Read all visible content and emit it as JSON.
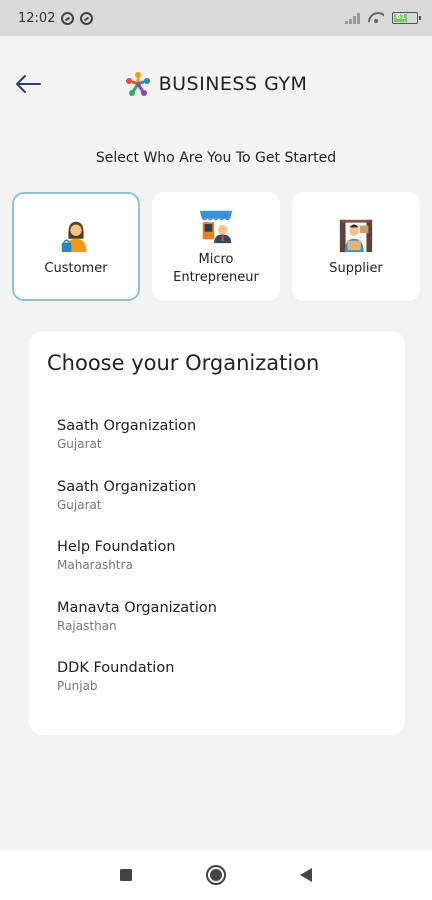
{
  "status_bar": {
    "time": "12:02",
    "battery_level": "61"
  },
  "header": {
    "title": "BUSINESS GYM"
  },
  "prompt": "Select Who Are You To Get Started",
  "roles": [
    {
      "label": "Customer",
      "selected": true
    },
    {
      "label": "Micro Entrepreneur",
      "selected": false
    },
    {
      "label": "Supplier",
      "selected": false
    }
  ],
  "organization_section": {
    "heading": "Choose your Organization",
    "items": [
      {
        "name": "Saath Organization",
        "state": "Gujarat"
      },
      {
        "name": "Saath Organization",
        "state": "Gujarat"
      },
      {
        "name": "Help Foundation",
        "state": "Maharashtra"
      },
      {
        "name": "Manavta Organization",
        "state": "Rajasthan"
      },
      {
        "name": "DDK Foundation",
        "state": "Punjab"
      }
    ]
  },
  "colors": {
    "selected_border": "#8ec3cc",
    "logo_orange": "#f39c12",
    "logo_blue": "#2e86c1",
    "logo_red": "#e74c3c",
    "logo_green": "#27ae60"
  }
}
